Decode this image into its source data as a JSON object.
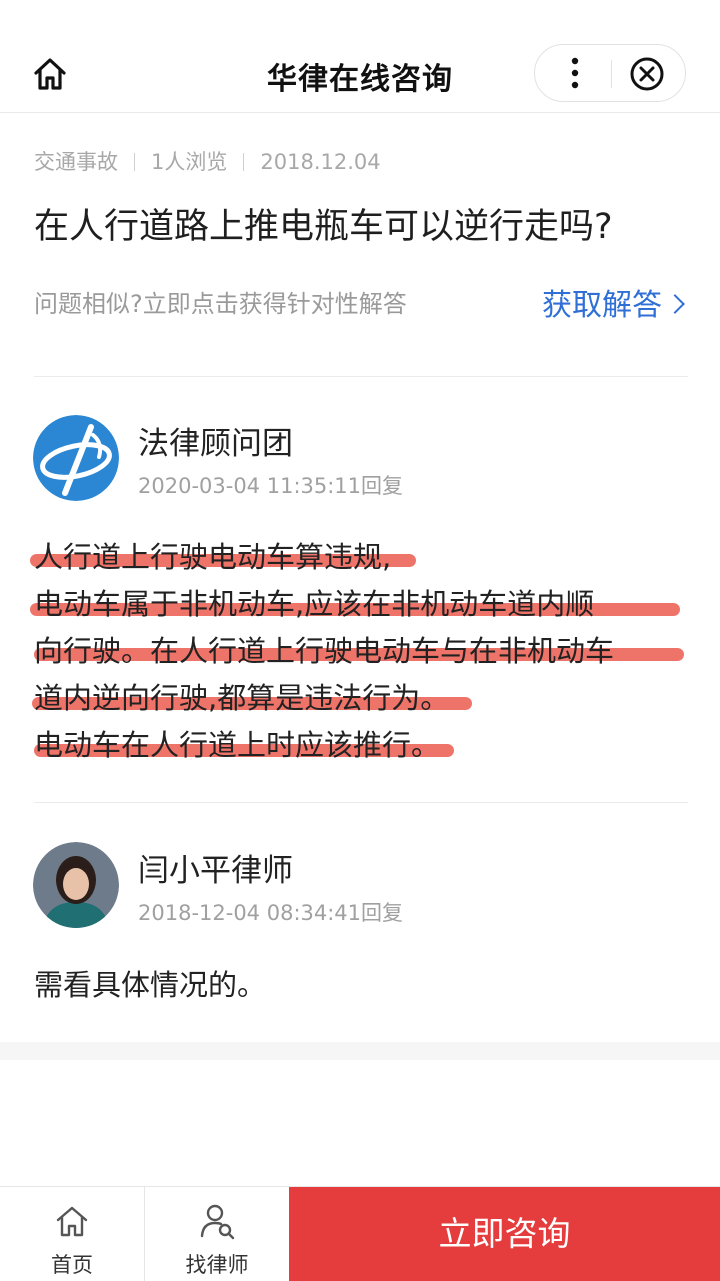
{
  "header": {
    "title": "华律在线咨询"
  },
  "question": {
    "category": "交通事故",
    "views": "1人浏览",
    "date": "2018.12.04",
    "title": "在人行道路上推电瓶车可以逆行走吗?",
    "similar_prompt": "问题相似?立即点击获得针对性解答",
    "get_answer_label": "获取解答"
  },
  "answers": [
    {
      "author": "法律顾问团",
      "time": "2020-03-04 11:35:11回复",
      "lines": [
        "人行道上行驶电动车算违规,",
        "电动车属于非机动车,应该在非机动车道内顺",
        "向行驶。在人行道上行驶电动车与在非机动车",
        "道内逆向行驶,都算是违法行为。",
        "电动车在人行道上时应该推行。"
      ]
    },
    {
      "author": "闫小平律师",
      "time": "2018-12-04 08:34:41回复",
      "text": "需看具体情况的。"
    }
  ],
  "tabbar": {
    "home_label": "首页",
    "find_lawyer_label": "找律师",
    "consult_label": "立即咨询"
  },
  "colors": {
    "accent_blue": "#2f6fd6",
    "consult_red": "#e53d3d",
    "highlight": "#e83e30"
  }
}
